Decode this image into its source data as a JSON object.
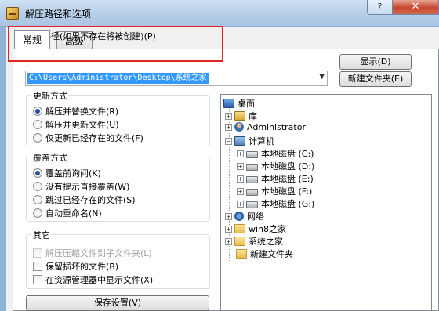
{
  "window": {
    "title": "解压路径和选项",
    "help_label": "?",
    "close_label": "✕"
  },
  "tabs": [
    {
      "label": "常规"
    },
    {
      "label": "高级"
    }
  ],
  "destination": {
    "label": "目标路径(如果不存在将被创建)(P)",
    "path_value": "C:\\Users\\Administrator\\Desktop\\系统之家",
    "show_button": "显示(D)",
    "new_folder_button": "新建文件夹(E)"
  },
  "update_mode": {
    "title": "更新方式",
    "options": [
      {
        "label": "解压并替换文件(R)",
        "selected": true
      },
      {
        "label": "解压并更新文件(U)",
        "selected": false
      },
      {
        "label": "仅更新已经存在的文件(F)",
        "selected": false
      }
    ]
  },
  "overwrite_mode": {
    "title": "覆盖方式",
    "options": [
      {
        "label": "覆盖前询问(K)",
        "selected": true
      },
      {
        "label": "没有提示直接覆盖(W)",
        "selected": false
      },
      {
        "label": "跳过已经存在的文件(S)",
        "selected": false
      },
      {
        "label": "自动重命名(N)",
        "selected": false
      }
    ]
  },
  "misc": {
    "title": "其它",
    "options": [
      {
        "label": "解压压缩文件到子文件夹(L)",
        "checked": false,
        "disabled": true
      },
      {
        "label": "保留损坏的文件(B)",
        "checked": false,
        "disabled": false
      },
      {
        "label": "在资源管理器中显示文件(X)",
        "checked": false,
        "disabled": false
      }
    ]
  },
  "save_button": "保存设置(V)",
  "tree": {
    "root": "桌面",
    "items": [
      {
        "label": "库",
        "icon": "library-icon"
      },
      {
        "label": "Administrator",
        "icon": "user-icon"
      },
      {
        "label": "计算机",
        "icon": "computer-icon"
      },
      {
        "label": "本地磁盘 (C:)",
        "icon": "drive-icon"
      },
      {
        "label": "本地磁盘 (D:)",
        "icon": "drive-icon"
      },
      {
        "label": "本地磁盘 (E:)",
        "icon": "drive-icon"
      },
      {
        "label": "本地磁盘 (F:)",
        "icon": "drive-icon"
      },
      {
        "label": "本地磁盘 (G:)",
        "icon": "drive-icon"
      },
      {
        "label": "网络",
        "icon": "network-icon"
      },
      {
        "label": "win8之家",
        "icon": "folder-icon"
      },
      {
        "label": "系统之家",
        "icon": "folder-icon"
      },
      {
        "label": "新建文件夹",
        "icon": "folder-icon"
      }
    ]
  }
}
